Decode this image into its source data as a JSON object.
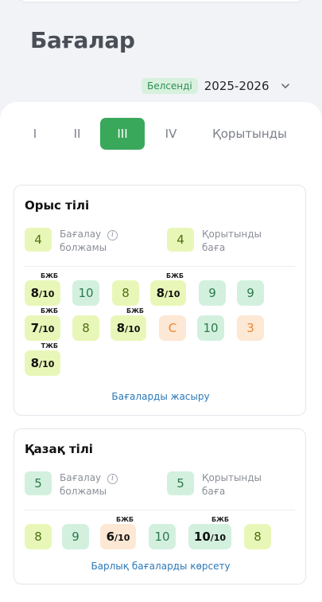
{
  "page": {
    "title": "Бағалар"
  },
  "year": {
    "status_badge": "Белсенді",
    "value": "2025-2026",
    "chevron_icon": "chevron-down-icon"
  },
  "tabs": [
    {
      "label": "I",
      "active": false
    },
    {
      "label": "II",
      "active": false
    },
    {
      "label": "III",
      "active": true
    },
    {
      "label": "IV",
      "active": false
    },
    {
      "label": "Қорытынды",
      "active": false
    }
  ],
  "subjects": [
    {
      "name": "Орыс тілі",
      "predicted": {
        "value": "4",
        "label_line1": "Бағалау",
        "label_line2": "болжамы"
      },
      "final": {
        "value": "4",
        "label_line1": "Қорытынды",
        "label_line2": "баға"
      },
      "grades": [
        {
          "num": "8",
          "den": "/10",
          "tag": "БЖБ",
          "color": "lime"
        },
        {
          "num": "10",
          "color": "mint"
        },
        {
          "num": "8",
          "color": "lime"
        },
        {
          "num": "8",
          "den": "/10",
          "tag": "БЖБ",
          "color": "lime"
        },
        {
          "num": "9",
          "color": "mint"
        },
        {
          "num": "9",
          "color": "mint"
        },
        {
          "num": "7",
          "den": "/10",
          "tag": "БЖБ",
          "color": "lime"
        },
        {
          "num": "8",
          "color": "lime"
        },
        {
          "num": "8",
          "den": "/10",
          "tag": "БЖБ",
          "color": "lime"
        },
        {
          "num": "С",
          "color": "peach"
        },
        {
          "num": "10",
          "color": "mint"
        },
        {
          "num": "3",
          "color": "peach"
        },
        {
          "num": "8",
          "den": "/10",
          "tag": "ТЖБ",
          "color": "lime"
        }
      ],
      "link": "Бағаларды жасыру"
    },
    {
      "name": "Қазақ тілі",
      "predicted": {
        "value": "5",
        "label_line1": "Бағалау",
        "label_line2": "болжамы"
      },
      "final": {
        "value": "5",
        "label_line1": "Қорытынды",
        "label_line2": "баға"
      },
      "grades": [
        {
          "num": "8",
          "color": "lime"
        },
        {
          "num": "9",
          "color": "mint"
        },
        {
          "num": "6",
          "den": "/10",
          "tag": "БЖБ",
          "color": "peach"
        },
        {
          "num": "10",
          "color": "mint"
        },
        {
          "num": "10",
          "den": "/10",
          "tag": "БЖБ",
          "color": "mint"
        },
        {
          "num": "8",
          "color": "lime"
        }
      ],
      "link": "Барлық бағаларды көрсету"
    }
  ],
  "colors": {
    "accent": "#3aa85b",
    "link": "#2b78b8"
  }
}
